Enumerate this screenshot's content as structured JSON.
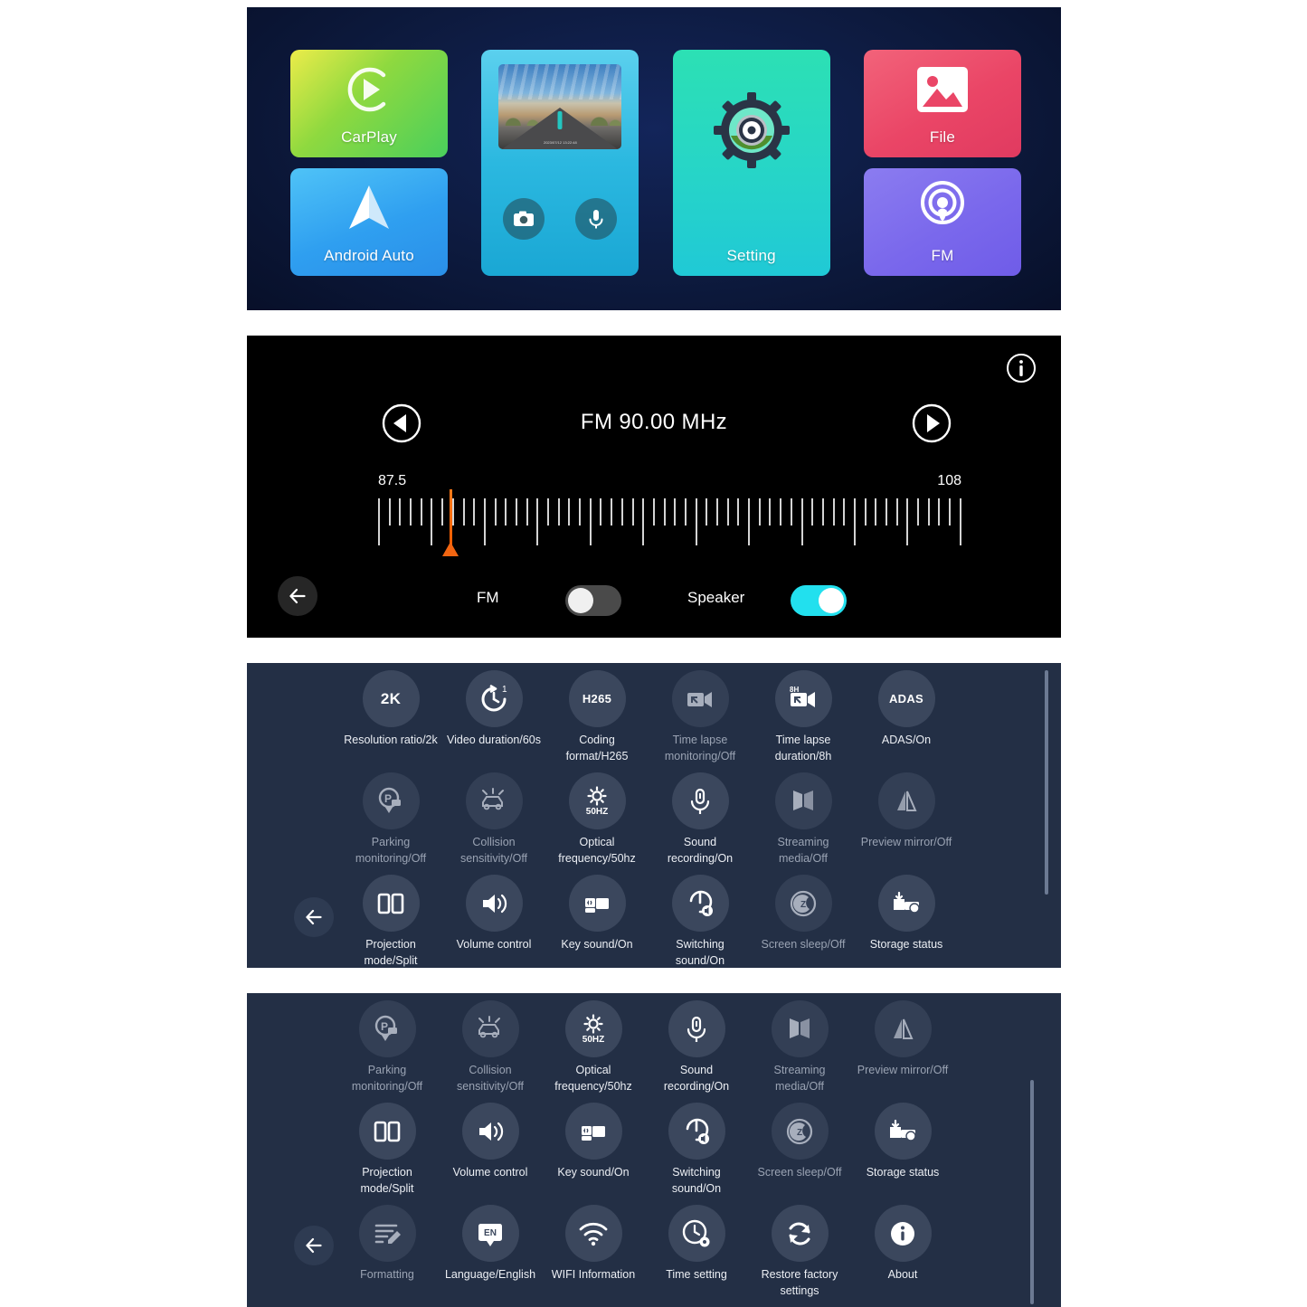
{
  "home": {
    "tiles": [
      {
        "id": "carplay",
        "label": "CarPlay",
        "icon": "carplay-icon",
        "color": "#8fd93f"
      },
      {
        "id": "android-auto",
        "label": "Android Auto",
        "icon": "android-auto-icon",
        "color": "#2f9ff0"
      },
      {
        "id": "dashcam",
        "label": "",
        "icon": "dashcam-preview-icon",
        "color": "#2bb8e0"
      },
      {
        "id": "setting",
        "label": "Setting",
        "icon": "gear-icon",
        "color": "#27d6c6"
      },
      {
        "id": "file",
        "label": "File",
        "icon": "image-icon",
        "color": "#ea4566"
      },
      {
        "id": "fm",
        "label": "FM",
        "icon": "broadcast-icon",
        "color": "#7a68ec"
      }
    ],
    "dashcam": {
      "timestamp": "2023/07/12  13:22:48",
      "capture_icon": "camera-icon",
      "mic_icon": "microphone-icon"
    }
  },
  "fm_radio": {
    "info_icon": "info-icon",
    "prev_icon": "previous-icon",
    "next_icon": "next-icon",
    "back_icon": "back-arrow-icon",
    "frequency_display": "FM 90.00 MHz",
    "scale_min": "87.5",
    "scale_max": "108",
    "needle_position_pct": 12.2,
    "fm_toggle": {
      "label": "FM",
      "state": "off"
    },
    "speaker_toggle": {
      "label": "Speaker",
      "state": "on"
    },
    "accent_color": "#22e0ee",
    "needle_color": "#f26511"
  },
  "settings_panel_1": {
    "back_icon": "back-arrow-icon",
    "items": [
      {
        "label": "Resolution ratio/2k",
        "icon": "resolution-2k-icon",
        "badge": "2K",
        "dim": false
      },
      {
        "label": "Video duration/60s",
        "icon": "video-duration-icon",
        "badge": "",
        "dim": false
      },
      {
        "label": "Coding format/H265",
        "icon": "coding-format-icon",
        "badge": "H265",
        "dim": false
      },
      {
        "label": "Time lapse monitoring/Off",
        "icon": "time-lapse-monitor-icon",
        "badge": "",
        "dim": true
      },
      {
        "label": "Time lapse duration/8h",
        "icon": "time-lapse-duration-icon",
        "badge": "",
        "dim": false
      },
      {
        "label": "ADAS/On",
        "icon": "adas-icon",
        "badge": "ADAS",
        "dim": false
      },
      {
        "label": "Parking monitoring/Off",
        "icon": "parking-monitor-icon",
        "badge": "",
        "dim": true
      },
      {
        "label": "Collision sensitivity/Off",
        "icon": "collision-sensor-icon",
        "badge": "",
        "dim": true
      },
      {
        "label": "Optical frequency/50hz",
        "icon": "optical-frequency-icon",
        "badge": "50HZ",
        "dim": false
      },
      {
        "label": "Sound recording/On",
        "icon": "microphone-icon",
        "badge": "",
        "dim": false
      },
      {
        "label": "Streaming media/Off",
        "icon": "streaming-media-icon",
        "badge": "",
        "dim": true
      },
      {
        "label": "Preview mirror/Off",
        "icon": "preview-mirror-icon",
        "badge": "",
        "dim": true
      },
      {
        "label": "Projection mode/Split",
        "icon": "projection-split-icon",
        "badge": "",
        "dim": false
      },
      {
        "label": "Volume control",
        "icon": "volume-icon",
        "badge": "",
        "dim": false
      },
      {
        "label": "Key sound/On",
        "icon": "key-sound-icon",
        "badge": "",
        "dim": false
      },
      {
        "label": "Switching sound/On",
        "icon": "switching-sound-icon",
        "badge": "",
        "dim": false
      },
      {
        "label": "Screen sleep/Off",
        "icon": "screen-sleep-icon",
        "badge": "",
        "dim": true
      },
      {
        "label": "Storage status",
        "icon": "storage-status-icon",
        "badge": "",
        "dim": false
      }
    ]
  },
  "settings_panel_2": {
    "back_icon": "back-arrow-icon",
    "items": [
      {
        "label": "Parking monitoring/Off",
        "icon": "parking-monitor-icon",
        "badge": "",
        "dim": true
      },
      {
        "label": "Collision sensitivity/Off",
        "icon": "collision-sensor-icon",
        "badge": "",
        "dim": true
      },
      {
        "label": "Optical frequency/50hz",
        "icon": "optical-frequency-icon",
        "badge": "50HZ",
        "dim": false
      },
      {
        "label": "Sound recording/On",
        "icon": "microphone-icon",
        "badge": "",
        "dim": false
      },
      {
        "label": "Streaming media/Off",
        "icon": "streaming-media-icon",
        "badge": "",
        "dim": true
      },
      {
        "label": "Preview mirror/Off",
        "icon": "preview-mirror-icon",
        "badge": "",
        "dim": true
      },
      {
        "label": "Projection mode/Split",
        "icon": "projection-split-icon",
        "badge": "",
        "dim": false
      },
      {
        "label": "Volume control",
        "icon": "volume-icon",
        "badge": "",
        "dim": false
      },
      {
        "label": "Key sound/On",
        "icon": "key-sound-icon",
        "badge": "",
        "dim": false
      },
      {
        "label": "Switching sound/On",
        "icon": "switching-sound-icon",
        "badge": "",
        "dim": false
      },
      {
        "label": "Screen sleep/Off",
        "icon": "screen-sleep-icon",
        "badge": "",
        "dim": true
      },
      {
        "label": "Storage status",
        "icon": "storage-status-icon",
        "badge": "",
        "dim": false
      },
      {
        "label": "Formatting",
        "icon": "formatting-icon",
        "badge": "",
        "dim": true
      },
      {
        "label": "Language/English",
        "icon": "language-icon",
        "badge": "EN",
        "dim": false
      },
      {
        "label": "WIFI Information",
        "icon": "wifi-icon",
        "badge": "",
        "dim": false
      },
      {
        "label": "Time setting",
        "icon": "time-setting-icon",
        "badge": "",
        "dim": false
      },
      {
        "label": "Restore factory settings",
        "icon": "restore-factory-icon",
        "badge": "",
        "dim": false
      },
      {
        "label": "About",
        "icon": "about-icon",
        "badge": "",
        "dim": false
      }
    ]
  }
}
